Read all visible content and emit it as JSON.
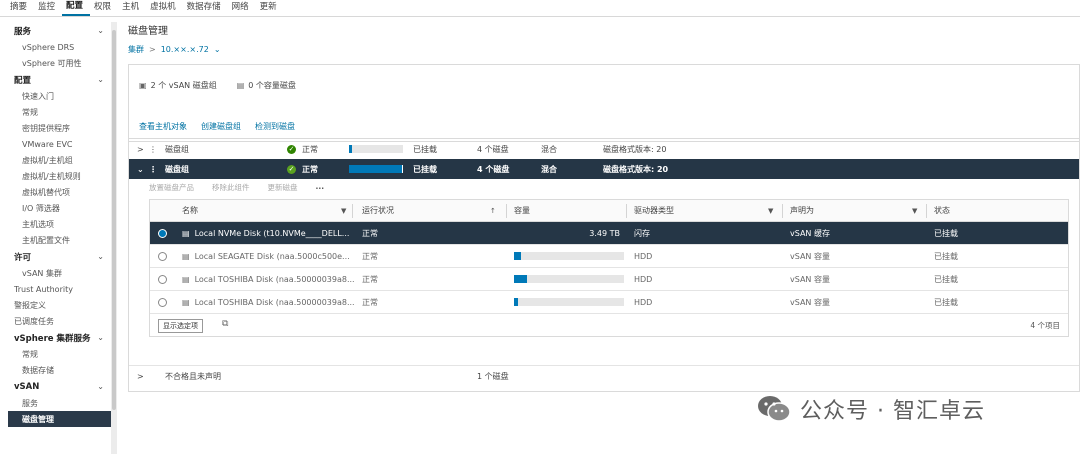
{
  "top_tabs": [
    "摘要",
    "监控",
    "配置",
    "权限",
    "主机",
    "虚拟机",
    "数据存储",
    "网络",
    "更新"
  ],
  "active_top_tab": "配置",
  "sidebar": {
    "groups": [
      {
        "label": "服务",
        "items": [
          "vSphere DRS",
          "vSphere 可用性"
        ]
      },
      {
        "label": "配置",
        "items": [
          "快速入门",
          "常规",
          "密钥提供程序",
          "VMware EVC",
          "虚拟机/主机组",
          "虚拟机/主机规则",
          "虚拟机替代项",
          "I/O 筛选器",
          "主机选项",
          "主机配置文件"
        ]
      },
      {
        "label": "许可",
        "items": [
          "vSAN 集群"
        ]
      }
    ],
    "plain_items": [
      "Trust Authority",
      "警报定义",
      "已调度任务"
    ],
    "group_vsphere_cluster": {
      "label": "vSphere 集群服务",
      "items": [
        "常规",
        "数据存储"
      ]
    },
    "group_vsan": {
      "label": "vSAN",
      "items": [
        "服务",
        "磁盘管理"
      ]
    },
    "active_item": "磁盘管理"
  },
  "main": {
    "title": "磁盘管理",
    "breadcrumb": {
      "root": "集群",
      "current": "10.××.×.72"
    },
    "summary": {
      "disk_groups": "2 个 vSAN 磁盘组",
      "capacity_disks": "0 个容量磁盘"
    },
    "links": [
      "查看主机对象",
      "创建磁盘组",
      "检测到磁盘"
    ],
    "disk_groups": [
      {
        "name": "磁盘组",
        "status": "正常",
        "usage": 0.05,
        "state": "已挂载",
        "disks": "4 个磁盘",
        "type": "混合",
        "format": "磁盘格式版本: 20"
      },
      {
        "name": "磁盘组",
        "status": "正常",
        "usage": 0.98,
        "state": "已挂载",
        "disks": "4 个磁盘",
        "type": "混合",
        "format": "磁盘格式版本: 20"
      }
    ],
    "toolbar": [
      "放置磁盘产品",
      "移除此组件",
      "更新磁盘",
      "..."
    ],
    "columns": [
      "名称",
      "运行状况",
      "容量",
      "驱动器类型",
      "声明为",
      "状态"
    ],
    "rows": [
      {
        "name": "Local NVMe Disk (t10.NVMe____DELL...",
        "health": "正常",
        "capacity_text": "3.49 TB",
        "capacity": 0,
        "drive_type": "闪存",
        "claimed_as": "vSAN 缓存",
        "state": "已挂载",
        "selected": true
      },
      {
        "name": "Local SEAGATE Disk (naa.5000c500e...",
        "health": "正常",
        "capacity_text": "",
        "capacity": 0.06,
        "drive_type": "HDD",
        "claimed_as": "vSAN 容量",
        "state": "已挂载",
        "selected": false
      },
      {
        "name": "Local TOSHIBA Disk (naa.50000039a8...",
        "health": "正常",
        "capacity_text": "",
        "capacity": 0.12,
        "drive_type": "HDD",
        "claimed_as": "vSAN 容量",
        "state": "已挂载",
        "selected": false
      },
      {
        "name": "Local TOSHIBA Disk (naa.50000039a8...",
        "health": "正常",
        "capacity_text": "",
        "capacity": 0.04,
        "drive_type": "HDD",
        "claimed_as": "vSAN 容量",
        "state": "已挂载",
        "selected": false
      }
    ],
    "footer": {
      "button": "显示选定项",
      "count": "4 个项目"
    },
    "unclaimed": {
      "label": "不合格且未声明",
      "disks": "1 个磁盘"
    }
  },
  "watermark": "公众号 · 智汇卓云",
  "colors": {
    "accent": "#0079b8",
    "dark_row": "#253646",
    "ok_green": "#2f8400"
  }
}
